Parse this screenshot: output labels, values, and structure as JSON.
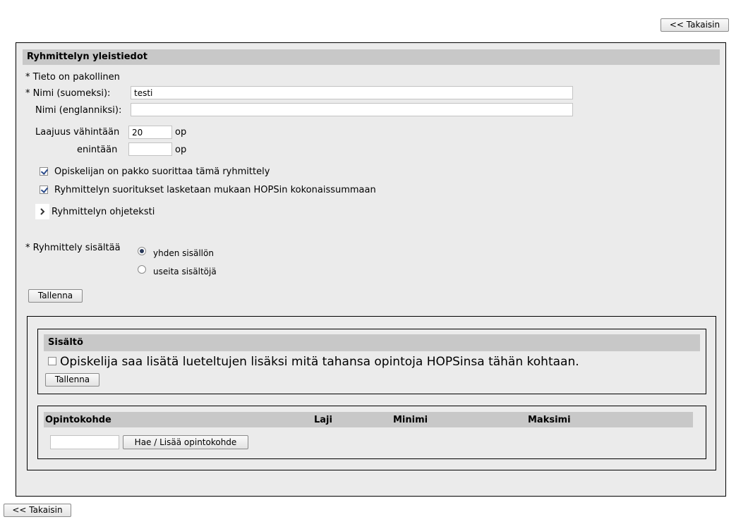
{
  "nav": {
    "back_label": "<< Takaisin"
  },
  "general": {
    "title": "Ryhmittelyn yleistiedot",
    "required_note": "* Tieto on pakollinen",
    "name_fi_label": "* Nimi (suomeksi):",
    "name_fi_value": "testi",
    "name_en_label": "Nimi (englanniksi):",
    "name_en_value": "",
    "scope_min_label": "Laajuus vähintään",
    "scope_min_value": "20",
    "scope_max_label": "enintään",
    "scope_max_value": "",
    "unit": "op",
    "mandatory_label": "Opiskelijan on pakko suorittaa tämä ryhmittely",
    "mandatory_checked": true,
    "count_label": "Ryhmittelyn suoritukset lasketaan mukaan HOPSin kokonaissummaan",
    "count_checked": true,
    "help_text_label": "Ryhmittelyn ohjeteksti",
    "contains_label": "* Ryhmittely sisältää",
    "contains_options": [
      {
        "label": "yhden sisällön",
        "selected": true
      },
      {
        "label": "useita sisältöjä",
        "selected": false
      }
    ],
    "save_label": "Tallenna"
  },
  "content": {
    "title": "Sisältö",
    "allow_label": "Opiskelija saa lisätä lueteltujen lisäksi mitä tahansa opintoja HOPSinsa tähän kohtaan.",
    "allow_checked": false,
    "save_label": "Tallenna"
  },
  "courses": {
    "columns": [
      "Opintokohde",
      "Laji",
      "Minimi",
      "Maksimi"
    ],
    "search_value": "",
    "search_button_label": "Hae / Lisää opintokohde"
  },
  "colors": {
    "panel_bg": "#ebebeb",
    "header_bg": "#c8c8c8",
    "border": "#000000"
  }
}
